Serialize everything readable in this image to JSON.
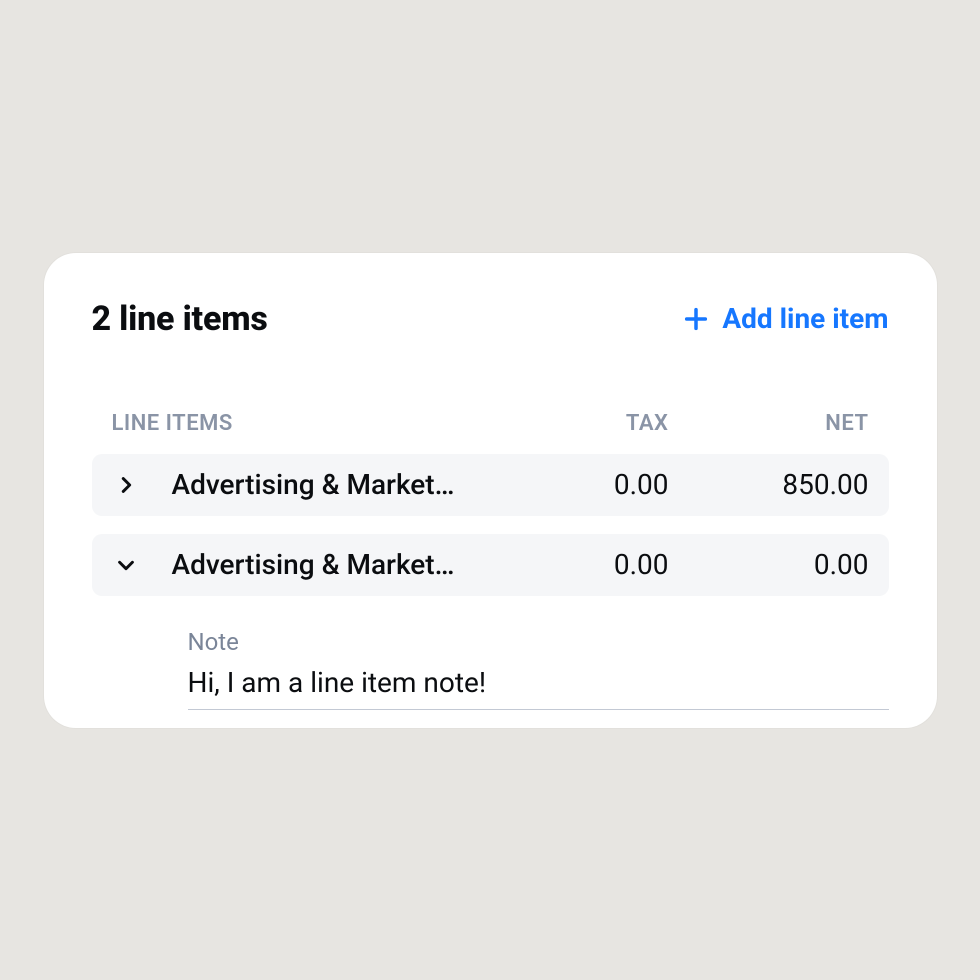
{
  "header": {
    "title": "2 line items",
    "add_label": "Add line item"
  },
  "columns": {
    "items": "LINE ITEMS",
    "tax": "TAX",
    "net": "NET"
  },
  "rows": [
    {
      "name": "Advertising & Market…",
      "tax": "0.00",
      "net": "850.00",
      "expanded": false
    },
    {
      "name": "Advertising & Market…",
      "tax": "0.00",
      "net": "0.00",
      "expanded": true
    }
  ],
  "note": {
    "label": "Note",
    "value": "Hi, I am a line item note!"
  }
}
